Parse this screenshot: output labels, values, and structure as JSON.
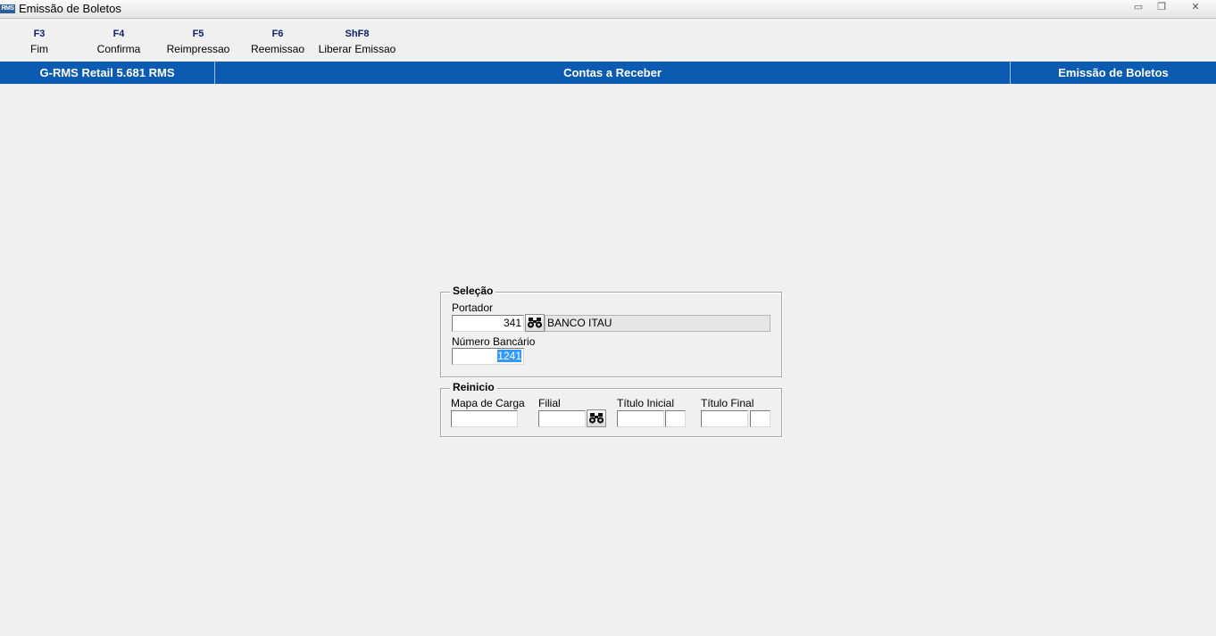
{
  "window": {
    "icon_text": "RMS",
    "title": "Emissão de Boletos",
    "minimize_symbol": "▭",
    "restore_symbol": "❐",
    "close_symbol": "✕"
  },
  "toolbar": {
    "f3": {
      "key": "F3",
      "label": "Fim"
    },
    "f4": {
      "key": "F4",
      "label": "Confirma"
    },
    "f5": {
      "key": "F5",
      "label": "Reimpressao"
    },
    "f6": {
      "key": "F6",
      "label": "Reemissao"
    },
    "shf8": {
      "key": "ShF8",
      "label": "Liberar Emissao"
    }
  },
  "header": {
    "system": "G-RMS Retail 5.681 RMS",
    "module": "Contas a Receber",
    "screen": "Emissão de Boletos"
  },
  "selecao": {
    "title": "Seleção",
    "portador_label": "Portador",
    "portador_value": "341",
    "portador_name": "BANCO ITAU",
    "numero_label": "Número Bancário",
    "numero_value": "1241"
  },
  "reinicio": {
    "title": "Reinicio",
    "mapa_label": "Mapa de Carga",
    "mapa_value": "",
    "filial_label": "Filial",
    "filial_value": "",
    "titulo_inicial_label": "Título Inicial",
    "titulo_inicial_value": "",
    "titulo_inicial_suffix": "",
    "titulo_final_label": "Título Final",
    "titulo_final_value": "",
    "titulo_final_suffix": ""
  },
  "colors": {
    "header_bar": "#0b5bb3",
    "function_key": "#0b1f6e",
    "selection": "#3399ff"
  },
  "icons": {
    "lookup": "binoculars-icon"
  }
}
